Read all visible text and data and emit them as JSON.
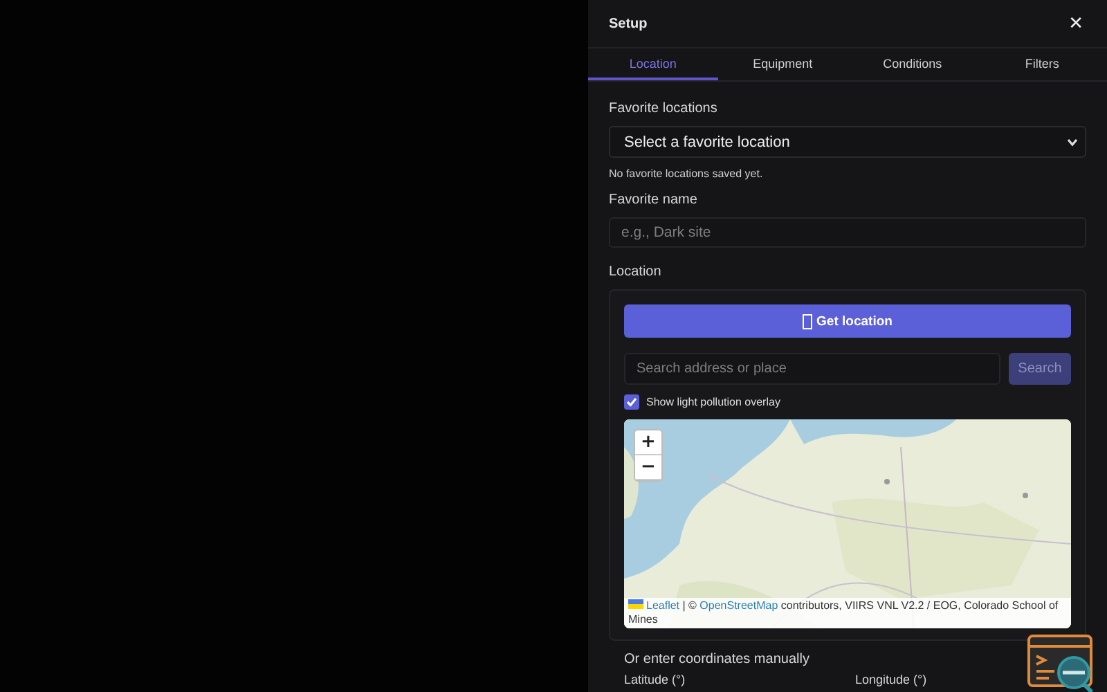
{
  "panel": {
    "title": "Setup",
    "close": "✕"
  },
  "tabs": [
    {
      "label": "Location",
      "selected": true
    },
    {
      "label": "Equipment",
      "selected": false
    },
    {
      "label": "Conditions",
      "selected": false
    },
    {
      "label": "Filters",
      "selected": false
    }
  ],
  "favorites": {
    "label": "Favorite locations",
    "select_value": "Select a favorite location",
    "note": "No favorite locations saved yet."
  },
  "favorite_name": {
    "label": "Favorite name",
    "placeholder": "e.g., Dark site"
  },
  "location": {
    "label": "Location",
    "get_button": "Get location",
    "search_placeholder": "Search address or place",
    "search_button": "Search",
    "overlay": {
      "label": "Show light pollution overlay",
      "checked": true
    },
    "map": {
      "kind": "picture",
      "zoom_in": "+",
      "zoom_out": "−",
      "attribution": [
        {
          "kind": "link",
          "text": "Leaflet"
        },
        {
          "kind": "text",
          "text": " | © "
        },
        {
          "kind": "link",
          "text": "OpenStreetMap"
        },
        {
          "kind": "text",
          "text": " contributors, VIIRS VNL V2.2 / EOG, Colorado School of Mines"
        }
      ]
    },
    "manual_note": "Or enter coordinates manually",
    "fields": [
      {
        "label": "Latitude (°)"
      },
      {
        "label": "Longitude (°)"
      }
    ]
  }
}
